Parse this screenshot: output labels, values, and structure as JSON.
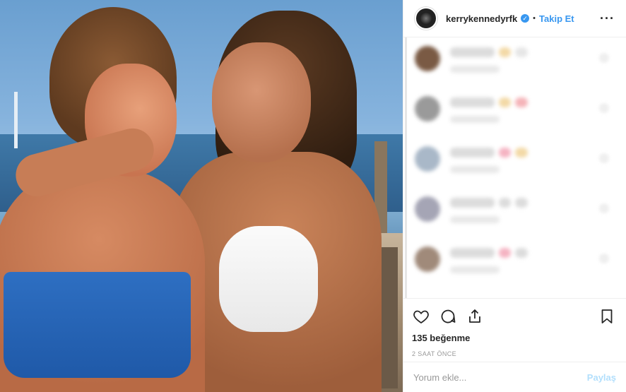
{
  "post": {
    "photo_icon": "photo",
    "header": {
      "username": "kerrykennedyrfk",
      "verified_icon": "verified-badge-icon",
      "separator": "•",
      "follow_label": "Takip Et",
      "more_icon": "more-options-icon"
    },
    "comments": [
      {
        "avatar_color": "#7a5a44",
        "emoji_colors": [
          "#f3d9a6",
          "#e6e6e6"
        ]
      },
      {
        "avatar_color": "#9a9a9a",
        "emoji_colors": [
          "#f3d9a6",
          "#f5b3b8"
        ]
      },
      {
        "avatar_color": "#a9b8c8",
        "emoji_colors": [
          "#f5b3c2",
          "#f3d9a6"
        ]
      },
      {
        "avatar_color": "#a5a5b5",
        "emoji_colors": [
          "#dcdcdc",
          "#dcdcdc"
        ]
      },
      {
        "avatar_color": "#a08a7a",
        "emoji_colors": [
          "#f5b3c2",
          "#dcdcdc"
        ]
      }
    ],
    "actions": {
      "like_icon": "heart-icon",
      "comment_icon": "comment-icon",
      "share_icon": "share-icon",
      "save_icon": "bookmark-icon"
    },
    "likes_text": "135 beğenme",
    "time_text": "2 SAAT ÖNCE",
    "comment_input": {
      "placeholder": "Yorum ekle...",
      "value": ""
    },
    "share_label": "Paylaş",
    "colors": {
      "link_blue": "#3897f0",
      "share_disabled": "#b2dffc",
      "border": "#efefef"
    }
  }
}
